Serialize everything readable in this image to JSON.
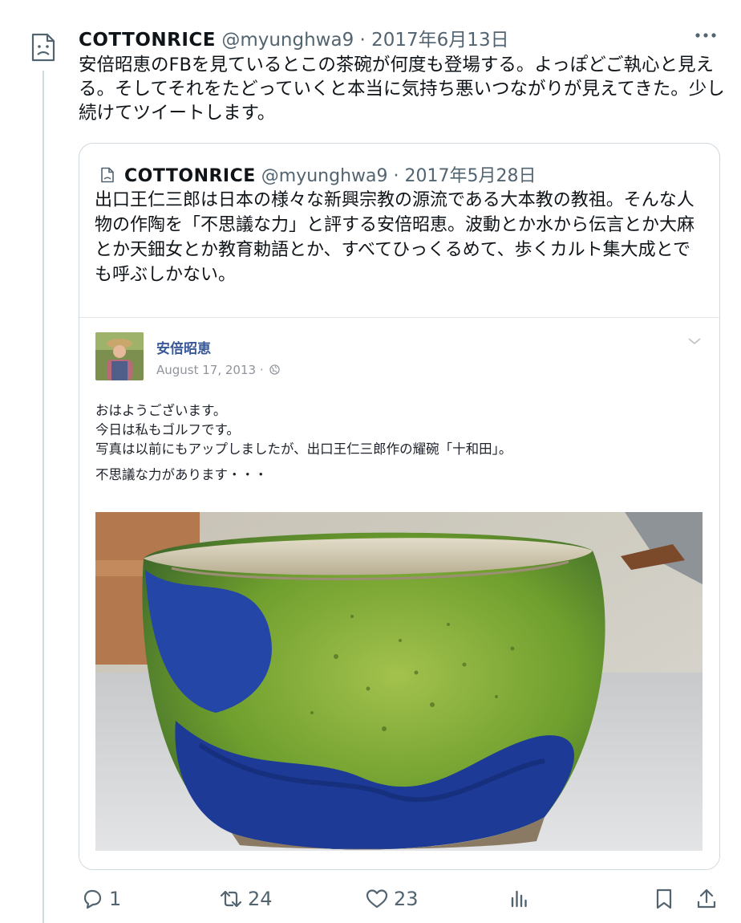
{
  "tweet": {
    "author": "COTTONRICE",
    "handle": "@myunghwa9",
    "separator": "·",
    "date": "2017年6月13日",
    "text": "安倍昭恵のFBを見ているとこの茶碗が何度も登場する。よっぽどご執心と見える。そしてそれをたどっていくと本当に気持ち悪いつながりが見えてきた。少し続けてツイートします。",
    "more_icon": "more-horizontal-icon",
    "avatar_icon": "broken-image-icon"
  },
  "quoted": {
    "author": "COTTONRICE",
    "handle": "@myunghwa9",
    "separator": "·",
    "date": "2017年5月28日",
    "text": "出口王仁三郎は日本の様々な新興宗教の源流である大本教の教祖。そんな人物の作陶を「不思議な力」と評する安倍昭恵。波動とか水から伝言とか大麻とか天鈿女とか教育勅語とか、すべてひっくるめて、歩くカルト集大成とでも呼ぶしかない。"
  },
  "fb_post": {
    "name": "安倍昭恵",
    "date": "August 17, 2013 ·",
    "lines": [
      "おはようございます。",
      "今日は私もゴルフです。",
      "写真は以前にもアップしましたが、出口王仁三郎作の耀碗「十和田」。",
      "不思議な力があります・・・"
    ]
  },
  "actions": {
    "reply": {
      "icon": "reply-icon",
      "count": "1"
    },
    "retweet": {
      "icon": "retweet-icon",
      "count": "24"
    },
    "like": {
      "icon": "heart-icon",
      "count": "23"
    },
    "views": {
      "icon": "analytics-icon"
    },
    "bookmark": {
      "icon": "bookmark-icon"
    },
    "share": {
      "icon": "share-icon"
    }
  },
  "colors": {
    "text": "#0f1419",
    "secondary": "#536471",
    "border": "#cfd9de",
    "fb_name": "#385898",
    "bowl_green": "#7fae3a",
    "bowl_blue": "#1f3f9a"
  }
}
